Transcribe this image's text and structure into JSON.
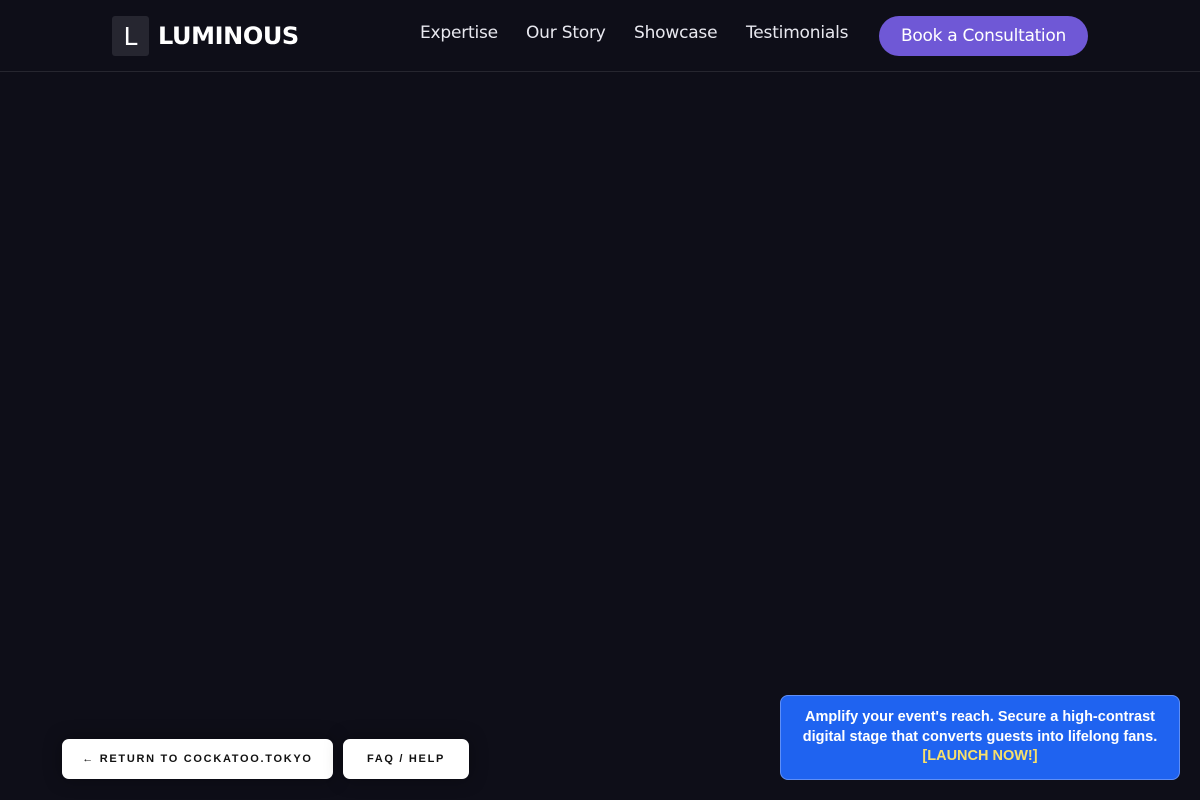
{
  "header": {
    "logo_letter": "L",
    "brand": "LUMINOUS",
    "nav": [
      "Expertise",
      "Our Story",
      "Showcase",
      "Testimonials"
    ],
    "cta_label": "Book a Consultation"
  },
  "footer_buttons": {
    "return_label": "← RETURN TO COCKATOO.TOKYO",
    "faq_label": "FAQ / HELP"
  },
  "promo": {
    "text": "Amplify your event's reach. Secure a high-contrast digital stage that converts guests into lifelong fans.",
    "cta": "[LAUNCH NOW!]"
  },
  "colors": {
    "background": "#0e0e18",
    "accent": "#6f58d6",
    "promo_bg": "#1f63f0",
    "promo_cta": "#f8e06a"
  }
}
